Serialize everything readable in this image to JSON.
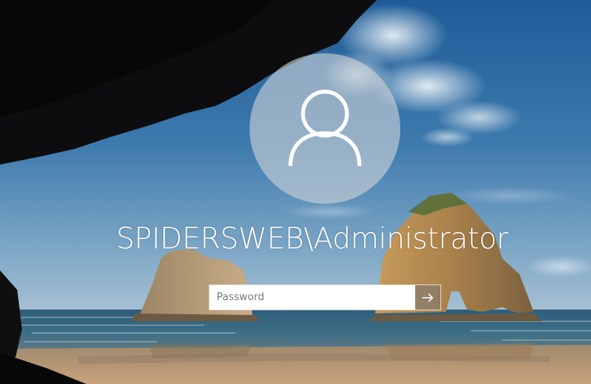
{
  "lock_screen": {
    "account_name": "SPIDERSWEB\\Administrator",
    "avatar_icon": "user-icon",
    "password_field": {
      "placeholder": "Password",
      "value": ""
    },
    "submit_icon": "arrow-right-icon"
  },
  "colors": {
    "input_background": "#ffffff",
    "avatar_circle": "#cdd2d6",
    "text": "#ffffff"
  }
}
